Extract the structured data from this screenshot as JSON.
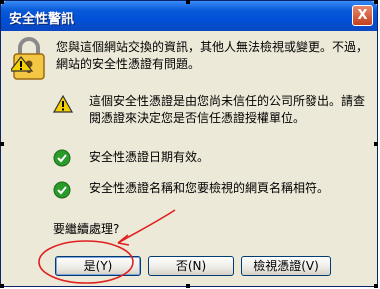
{
  "window": {
    "title": "安全性警訊",
    "close_label": "X"
  },
  "messages": {
    "intro": "您與這個網站交換的資訊，其他人無法檢視或變更。不過，網站的安全性憑證有問題。",
    "cert_issuer": "這個安全性憑證是由您尚未信任的公司所發出。請查閱憑證來決定您是否信任憑證授權單位。",
    "cert_date": "安全性憑證日期有效。",
    "cert_name": "安全性憑證名稱和您要檢視的網頁名稱相符。",
    "prompt": "要繼續處理?"
  },
  "buttons": {
    "yes": "是(Y)",
    "no": "否(N)",
    "view": "檢視憑證(V)"
  },
  "colors": {
    "titlebar": "#0a5bd8",
    "dialog_bg": "#ece9d8",
    "annotation_red": "#e02020",
    "check_green": "#2a9a2a",
    "warning_yellow": "#f5d000"
  }
}
